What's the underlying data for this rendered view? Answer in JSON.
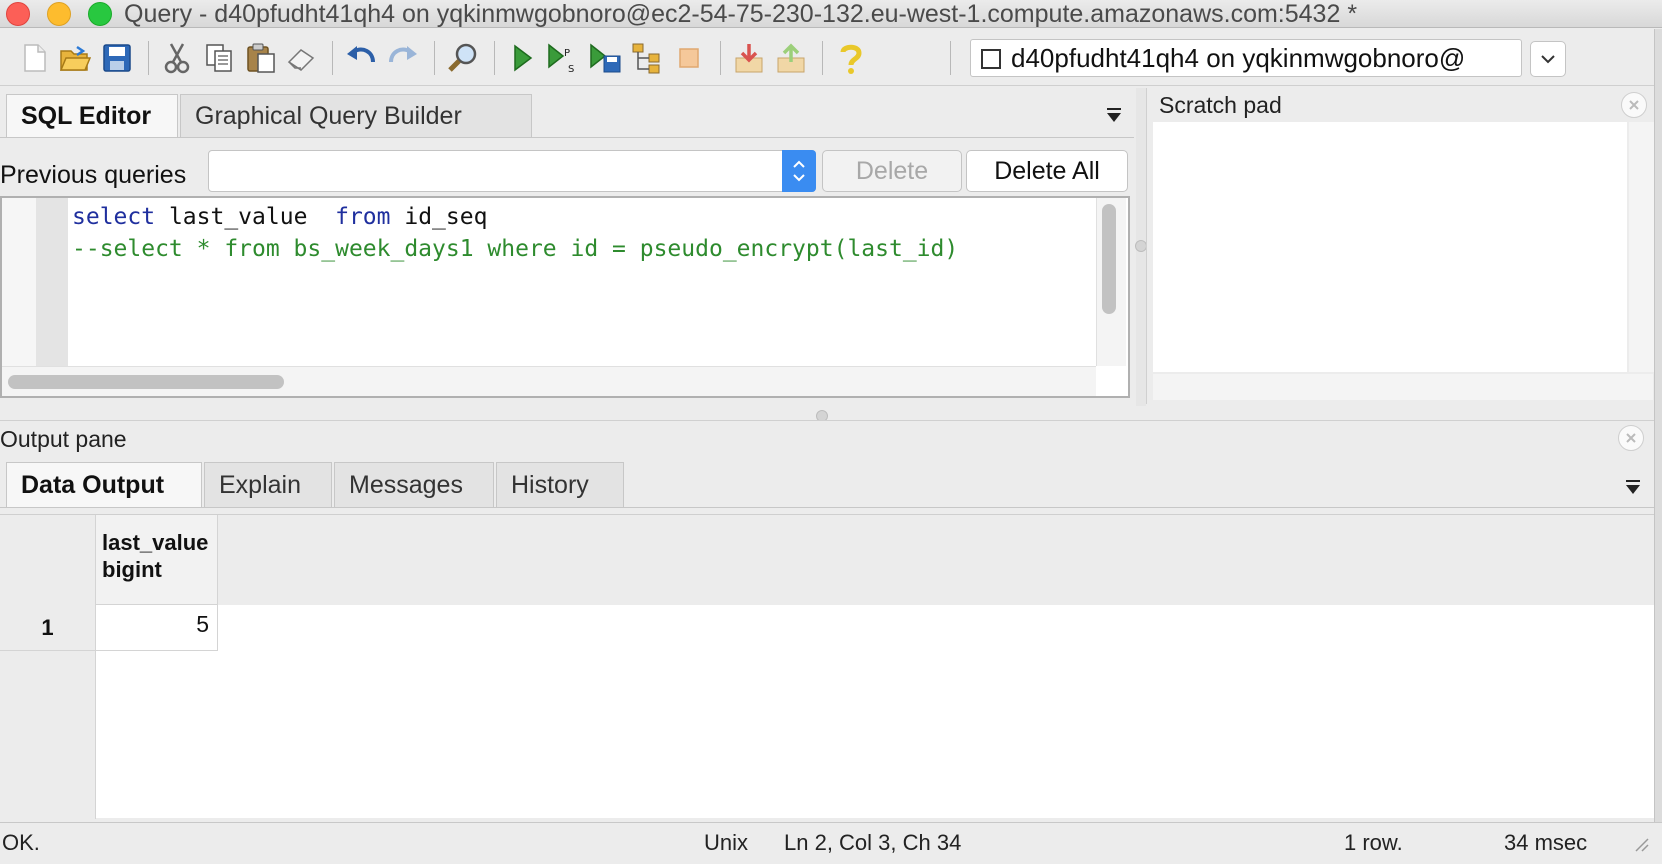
{
  "window": {
    "title": "Query - d40pfudht41qh4 on yqkinmwgobnoro@ec2-54-75-230-132.eu-west-1.compute.amazonaws.com:5432 *"
  },
  "toolbar": {
    "icons": [
      "new-file-icon",
      "open-folder-icon",
      "save-icon",
      "cut-icon",
      "copy-icon",
      "paste-icon",
      "eraser-icon",
      "undo-icon",
      "redo-icon",
      "find-icon",
      "execute-icon",
      "execute-pgscript-icon",
      "execute-to-file-icon",
      "explain-icon",
      "cancel-icon",
      "export-icon",
      "import-icon",
      "help-icon"
    ],
    "connection": {
      "label": "d40pfudht41qh4 on yqkinmwgobnoro@"
    }
  },
  "editor": {
    "tabs": [
      {
        "label": "SQL Editor",
        "active": true
      },
      {
        "label": "Graphical Query Builder",
        "active": false
      }
    ],
    "previous_queries_label": "Previous queries",
    "previous_queries_value": "",
    "delete_label": "Delete",
    "delete_all_label": "Delete All",
    "code": {
      "line1": {
        "kw1": "select",
        "mid": " last_value  ",
        "kw2": "from",
        "tail": " id_seq"
      },
      "line2": "--select * from bs_week_days1 where id = pseudo_encrypt(last_id)"
    }
  },
  "scratch_pad": {
    "title": "Scratch pad",
    "content": ""
  },
  "output": {
    "title": "Output pane",
    "tabs": [
      {
        "label": "Data Output",
        "active": true
      },
      {
        "label": "Explain",
        "active": false
      },
      {
        "label": "Messages",
        "active": false
      },
      {
        "label": "History",
        "active": false
      }
    ],
    "grid": {
      "columns": [
        {
          "name": "last_value",
          "type": "bigint"
        }
      ],
      "rows": [
        {
          "num": "1",
          "values": [
            "5"
          ]
        }
      ]
    }
  },
  "status": {
    "state": "OK.",
    "line_ending": "Unix",
    "cursor": "Ln 2, Col 3, Ch 34",
    "rows": "1 row.",
    "time": "34 msec"
  },
  "colors": {
    "keyword": "#1f2f9e",
    "comment": "#2e8b2e",
    "stepper_accent": "#3a8cf1"
  }
}
